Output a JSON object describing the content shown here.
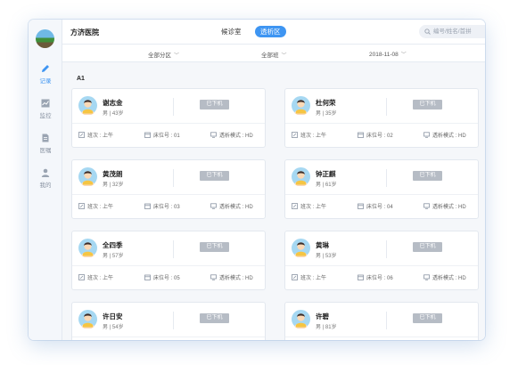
{
  "app": {
    "hospital_name": "方济医院",
    "tabs": [
      {
        "label": "候诊室",
        "active": false
      },
      {
        "label": "透析区",
        "active": true
      }
    ],
    "search_placeholder": "编号/姓名/首拼"
  },
  "sidebar": {
    "items": [
      {
        "label": "记录",
        "icon": "pencil-icon",
        "active": true
      },
      {
        "label": "监控",
        "icon": "chart-icon",
        "active": false
      },
      {
        "label": "医嘱",
        "icon": "document-icon",
        "active": false
      },
      {
        "label": "我的",
        "icon": "user-icon",
        "active": false
      }
    ]
  },
  "filters": {
    "zone": "全部分区",
    "shift": "全部班",
    "date": "2018-11-08"
  },
  "zone_label": "A1",
  "labels": {
    "shift": "班次",
    "bed": "床位号",
    "mode": "透析模式"
  },
  "colors": {
    "accent": "#3e95f2",
    "badge": "#b6bcc5"
  },
  "patients": [
    {
      "name": "谢志金",
      "meta": "男 | 43岁",
      "status": "已下机",
      "shift": "上午",
      "bed": "01",
      "mode": "HD"
    },
    {
      "name": "杜何荣",
      "meta": "男 | 35岁",
      "status": "已下机",
      "shift": "上午",
      "bed": "02",
      "mode": "HD"
    },
    {
      "name": "黄茂朗",
      "meta": "男 | 32岁",
      "status": "已下机",
      "shift": "上午",
      "bed": "03",
      "mode": "HD"
    },
    {
      "name": "钟正麒",
      "meta": "男 | 61岁",
      "status": "已下机",
      "shift": "上午",
      "bed": "04",
      "mode": "HD"
    },
    {
      "name": "全四季",
      "meta": "男 | 57岁",
      "status": "已下机",
      "shift": "上午",
      "bed": "05",
      "mode": "HD"
    },
    {
      "name": "黄琳",
      "meta": "男 | 53岁",
      "status": "已下机",
      "shift": "上午",
      "bed": "06",
      "mode": "HD"
    },
    {
      "name": "许日安",
      "meta": "男 | 54岁",
      "status": "已下机",
      "shift": "",
      "bed": "",
      "mode": ""
    },
    {
      "name": "许碧",
      "meta": "男 | 81岁",
      "status": "已下机",
      "shift": "",
      "bed": "",
      "mode": ""
    }
  ]
}
